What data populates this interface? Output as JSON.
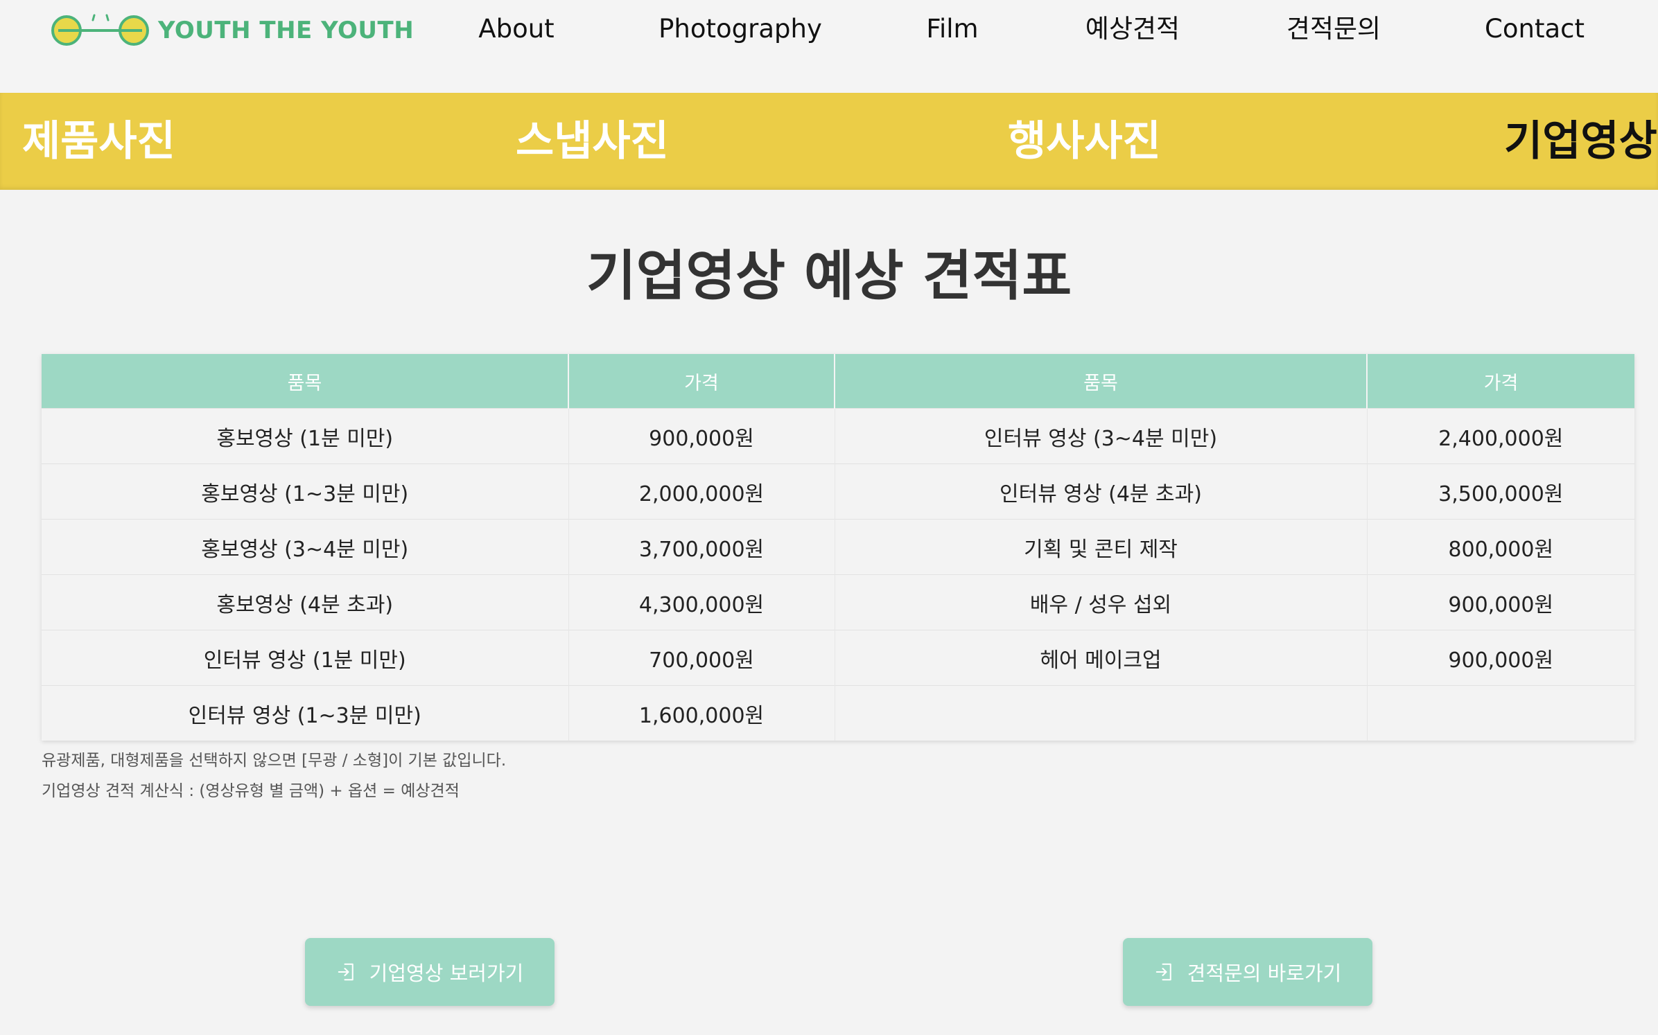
{
  "brand": {
    "name": "YOUTH THE YOUTH",
    "color": "#4cb37a",
    "logo_accent": "#e8d84a"
  },
  "nav": {
    "items": [
      "About",
      "Photography",
      "Film",
      "예상견적",
      "견적문의",
      "Contact"
    ]
  },
  "categories": {
    "items": [
      "제품사진",
      "스냅사진",
      "행사사진",
      "기업영상"
    ],
    "active_index": 3,
    "bar_color": "#ebcd47"
  },
  "title": "기업영상 예상 견적표",
  "table": {
    "headers": [
      "품목",
      "가격",
      "품목",
      "가격"
    ],
    "header_color": "#9dd8c4",
    "rows": [
      [
        "홍보영상 (1분 미만)",
        "900,000원",
        "인터뷰 영상 (3~4분 미만)",
        "2,400,000원"
      ],
      [
        "홍보영상 (1~3분 미만)",
        "2,000,000원",
        "인터뷰 영상 (4분 초과)",
        "3,500,000원"
      ],
      [
        "홍보영상 (3~4분 미만)",
        "3,700,000원",
        "기획 및 콘티 제작",
        "800,000원"
      ],
      [
        "홍보영상 (4분 초과)",
        "4,300,000원",
        "배우 / 성우 섭외",
        "900,000원"
      ],
      [
        "인터뷰 영상 (1분 미만)",
        "700,000원",
        "헤어 메이크업",
        "900,000원"
      ],
      [
        "인터뷰 영상 (1~3분 미만)",
        "1,600,000원",
        "",
        ""
      ]
    ]
  },
  "notes": [
    "유광제품, 대형제품을 선택하지 않으면 [무광 / 소형]이 기본 값입니다.",
    "기업영상 견적 계산식 : (영상유형 별 금액) + 옵션 = 예상견적"
  ],
  "buttons": {
    "view_label": "기업영상 보러가기",
    "inquiry_label": "견적문의 바로가기",
    "icon": "login-arrow-icon",
    "color": "#9dd8c4"
  }
}
